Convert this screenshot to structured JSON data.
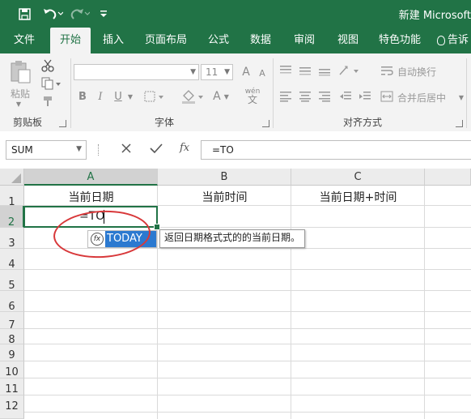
{
  "window": {
    "title": "新建 Microsoft"
  },
  "quick_access": {
    "save_icon": "save-icon",
    "undo_icon": "undo-icon",
    "redo_icon": "redo-icon",
    "customize_icon": "customize-icon"
  },
  "ribbon_tabs": [
    {
      "label": "文件",
      "active": false
    },
    {
      "label": "开始",
      "active": true
    },
    {
      "label": "插入",
      "active": false
    },
    {
      "label": "页面布局",
      "active": false
    },
    {
      "label": "公式",
      "active": false
    },
    {
      "label": "数据",
      "active": false
    },
    {
      "label": "审阅",
      "active": false
    },
    {
      "label": "视图",
      "active": false
    },
    {
      "label": "特色功能",
      "active": false
    },
    {
      "label": "告诉",
      "active": false
    }
  ],
  "ribbon": {
    "clipboard": {
      "paste_label": "粘贴",
      "group_label": "剪贴板"
    },
    "font": {
      "group_label": "字体",
      "font_name": "",
      "font_size": "11",
      "grow_label": "A",
      "shrink_label": "A",
      "bold": "B",
      "italic": "I",
      "underline": "U",
      "font_color_label": "A",
      "phonetic_label": "wén",
      "phonetic_char": "文"
    },
    "alignment": {
      "group_label": "对齐方式",
      "wrap_text": "自动换行",
      "merge_center": "合并后居中"
    }
  },
  "formula_bar": {
    "name_box": "SUM",
    "cancel_icon": "cancel-icon",
    "enter_icon": "enter-icon",
    "fx_label": "fx",
    "formula": "=TO"
  },
  "sheet": {
    "columns": [
      "A",
      "B",
      "C"
    ],
    "rows": [
      "1",
      "2",
      "3",
      "4",
      "5",
      "6",
      "7",
      "8",
      "9",
      "10",
      "11",
      "12"
    ],
    "cells": {
      "A1": "当前日期",
      "B1": "当前时间",
      "C1": "当前日期+时间"
    },
    "active_cell": "A2",
    "editing_text": "=TO"
  },
  "autocomplete": {
    "items": [
      {
        "label": "TODAY",
        "icon": "function-icon",
        "icon_label": "fx"
      }
    ],
    "tooltip": "返回日期格式式的的当前日期。"
  },
  "colors": {
    "accent": "#217346",
    "highlight": "#2b79d0",
    "annotation": "#d8383a"
  }
}
